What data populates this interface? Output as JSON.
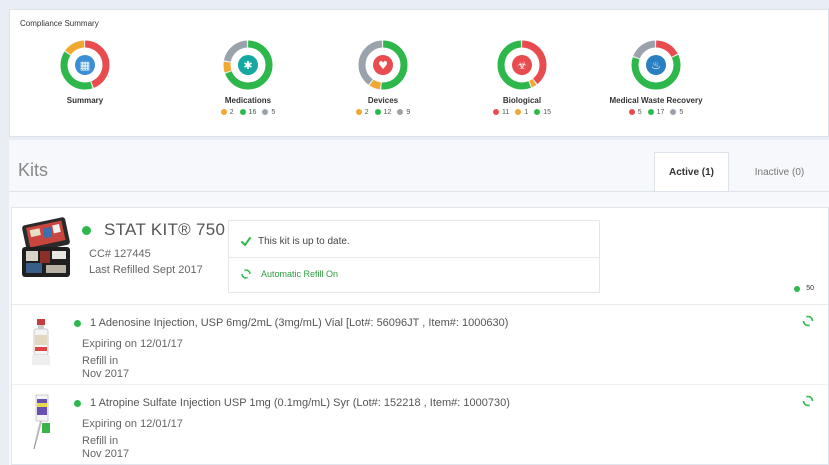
{
  "compliance": {
    "title": "Compliance Summary",
    "rings": [
      {
        "label": "Summary",
        "icon": "building-icon",
        "icon_color": "#3a8fd6",
        "segments": [
          {
            "color": "#e84c4f",
            "pct": 45
          },
          {
            "color": "#2eb84b",
            "pct": 40
          },
          {
            "color": "#f0a830",
            "pct": 15
          }
        ],
        "stats": []
      },
      {
        "label": "Medications",
        "icon": "star-of-life-icon",
        "icon_color": "#14a8a0",
        "segments": [
          {
            "color": "#2eb84b",
            "pct": 70
          },
          {
            "color": "#f0a830",
            "pct": 8
          },
          {
            "color": "#9aa3ab",
            "pct": 22
          }
        ],
        "stats": [
          {
            "color": "#f0a830",
            "value": "2"
          },
          {
            "color": "#2eb84b",
            "value": "16"
          },
          {
            "color": "#9aa3ab",
            "value": "5"
          }
        ]
      },
      {
        "label": "Devices",
        "icon": "heart-shield-icon",
        "icon_color": "#e84c4f",
        "segments": [
          {
            "color": "#2eb84b",
            "pct": 52
          },
          {
            "color": "#f0a830",
            "pct": 8
          },
          {
            "color": "#9aa3ab",
            "pct": 40
          }
        ],
        "stats": [
          {
            "color": "#f0a830",
            "value": "2"
          },
          {
            "color": "#2eb84b",
            "value": "12"
          },
          {
            "color": "#9aa3ab",
            "value": "9"
          }
        ]
      },
      {
        "label": "Biological",
        "icon": "biohazard-icon",
        "icon_color": "#e84c4f",
        "segments": [
          {
            "color": "#e84c4f",
            "pct": 40
          },
          {
            "color": "#f0a830",
            "pct": 4
          },
          {
            "color": "#2eb84b",
            "pct": 56
          }
        ],
        "stats": [
          {
            "color": "#e84c4f",
            "value": "11"
          },
          {
            "color": "#f0a830",
            "value": "1"
          },
          {
            "color": "#2eb84b",
            "value": "15"
          }
        ]
      },
      {
        "label": "Medical Waste Recovery",
        "icon": "recovery-icon",
        "icon_color": "#2a7fc1",
        "segments": [
          {
            "color": "#e84c4f",
            "pct": 18
          },
          {
            "color": "#2eb84b",
            "pct": 63
          },
          {
            "color": "#9aa3ab",
            "pct": 19
          }
        ],
        "stats": [
          {
            "color": "#e84c4f",
            "value": "5"
          },
          {
            "color": "#2eb84b",
            "value": "17"
          },
          {
            "color": "#9aa3ab",
            "value": "5"
          }
        ]
      }
    ]
  },
  "kits": {
    "title": "Kits",
    "tabs": [
      {
        "label": "Active (1)",
        "active": true
      },
      {
        "label": "Inactive (0)",
        "active": false
      }
    ],
    "kit": {
      "name": "STAT KIT® 750",
      "status_color": "#2eb84b",
      "cc": "CC# 127445",
      "last_refilled": "Last Refilled Sept 2017",
      "status_message": "This kit is up to date.",
      "refill_status": "Automatic Refill On",
      "count": "50",
      "count_color": "#2eb84b"
    },
    "items": [
      {
        "name": "1 Adenosine Injection, USP 6mg/2mL (3mg/mL) Vial [Lot#: 56096JT , Item#: 1000630)",
        "expiring": "Expiring on 12/01/17",
        "refill": "Refill in Nov 2017",
        "status_color": "#2eb84b"
      },
      {
        "name": "1 Atropine Sulfate Injection USP 1mg (0.1mg/mL) Syr (Lot#: 152218 , Item#: 1000730)",
        "expiring": "Expiring on 12/01/17",
        "refill": "Refill in Nov 2017",
        "status_color": "#2eb84b"
      }
    ]
  }
}
